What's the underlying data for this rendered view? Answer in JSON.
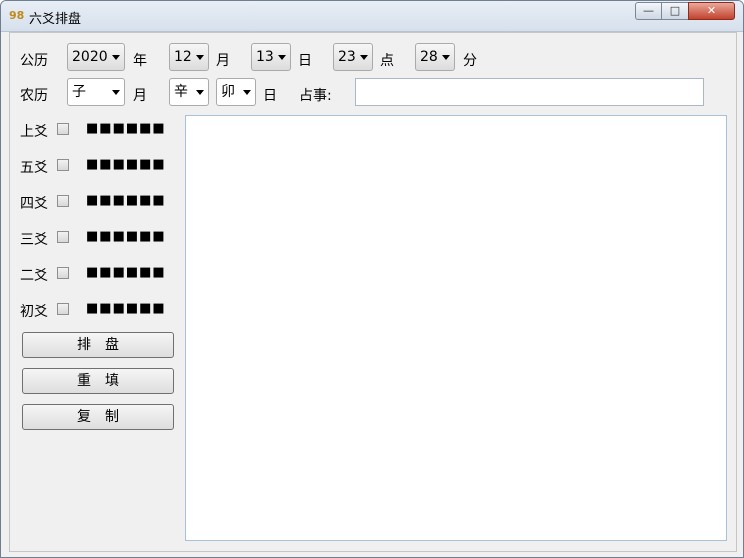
{
  "window": {
    "title": "六爻排盘",
    "app_icon": "98",
    "controls": {
      "minimize": "—",
      "maximize": "□",
      "close": "✕"
    }
  },
  "gregorian": {
    "label": "公历",
    "year": "2020",
    "year_unit": "年",
    "month": "12",
    "month_unit": "月",
    "day": "13",
    "day_unit": "日",
    "hour": "23",
    "hour_unit": "点",
    "minute": "28",
    "minute_unit": "分"
  },
  "lunar": {
    "label": "农历",
    "month": "子",
    "month_unit": "月",
    "day_stem": "辛",
    "day_branch": "卯",
    "day_unit": "日",
    "matter_label": "占事:",
    "matter_value": ""
  },
  "lines": [
    {
      "label": "上爻",
      "pattern": "■■■■■■"
    },
    {
      "label": "五爻",
      "pattern": "■■■■■■"
    },
    {
      "label": "四爻",
      "pattern": "■■■■■■"
    },
    {
      "label": "三爻",
      "pattern": "■■■■■■"
    },
    {
      "label": "二爻",
      "pattern": "■■■■■■"
    },
    {
      "label": "初爻",
      "pattern": "■■■■■■"
    }
  ],
  "buttons": {
    "arrange": "排　盘",
    "reset": "重　填",
    "copy": "复　制"
  },
  "output_text": ""
}
